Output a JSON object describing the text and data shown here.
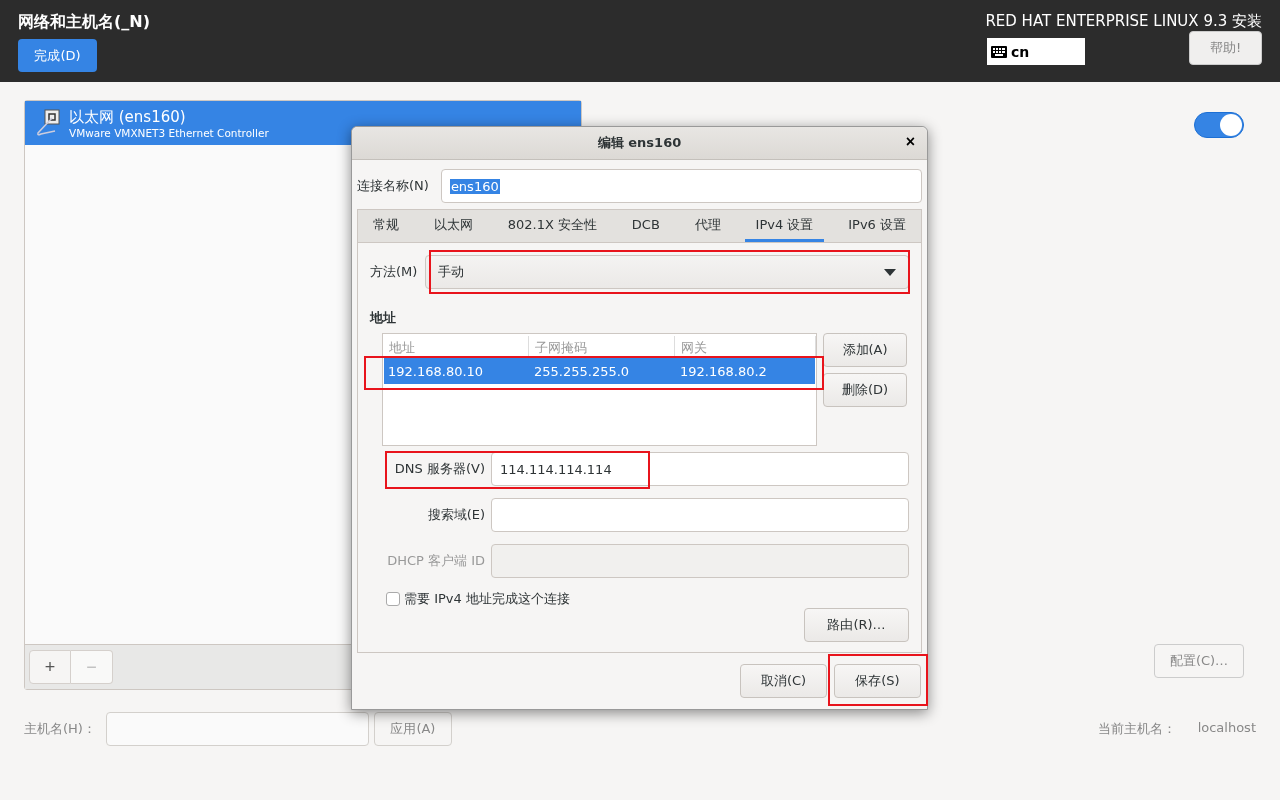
{
  "header": {
    "title": "网络和主机名(_N)",
    "done_button": "完成(D)",
    "product": "RED HAT ENTERPRISE LINUX 9.3 安装",
    "keyboard_layout": "cn",
    "help_button": "帮助!"
  },
  "devices": [
    {
      "name": "以太网 (ens160)",
      "description": "VMware VMXNET3 Ethernet Controller",
      "selected": true
    }
  ],
  "device_list_buttons": [
    {
      "label": "+",
      "disabled": false
    },
    {
      "label": "−",
      "disabled": true
    }
  ],
  "device_panel": {
    "on": true,
    "configure_button": "配置(C)…"
  },
  "hostname": {
    "label": "主机名(H)：",
    "apply_button": "应用(A)",
    "current_label": "当前主机名：",
    "current_value": "localhost"
  },
  "dialog": {
    "title": "编辑 ens160",
    "close": "×",
    "connection_name_label": "连接名称(N)",
    "connection_name": "ens160",
    "connection_name_selected": true,
    "tabs": [
      {
        "label": "常规",
        "selected": false
      },
      {
        "label": "以太网",
        "selected": false
      },
      {
        "label": "802.1X 安全性",
        "selected": false
      },
      {
        "label": "DCB",
        "selected": false
      },
      {
        "label": "代理",
        "selected": false
      },
      {
        "label": "IPv4 设置",
        "selected": true
      },
      {
        "label": "IPv6 设置",
        "selected": false
      }
    ],
    "method_label": "方法(M)",
    "method": {
      "value": "手动",
      "highlighted": true
    },
    "addresses_heading": "地址",
    "address_table": {
      "columns": [
        "地址",
        "子网掩码",
        "网关"
      ],
      "rows": [
        {
          "cells": [
            "192.168.80.10",
            "255.255.255.0",
            "192.168.80.2"
          ],
          "selected": true,
          "highlighted": true
        }
      ]
    },
    "add_button": "添加(A)",
    "delete_button": "删除(D)",
    "fields": [
      {
        "label": "DNS 服务器(V)",
        "value": "114.114.114.114",
        "disabled": false,
        "highlighted": true
      },
      {
        "label": "搜索域(E)",
        "disabled": false,
        "highlighted": false
      },
      {
        "label": "DHCP 客户端 ID",
        "disabled": true,
        "highlighted": false
      }
    ],
    "require_checkbox": {
      "label": "需要 IPv4 地址完成这个连接",
      "checked": false
    },
    "routes_button": "路由(R)…",
    "buttons": [
      {
        "label": "取消(C)",
        "highlighted": false
      },
      {
        "label": "保存(S)",
        "highlighted": true
      }
    ]
  }
}
